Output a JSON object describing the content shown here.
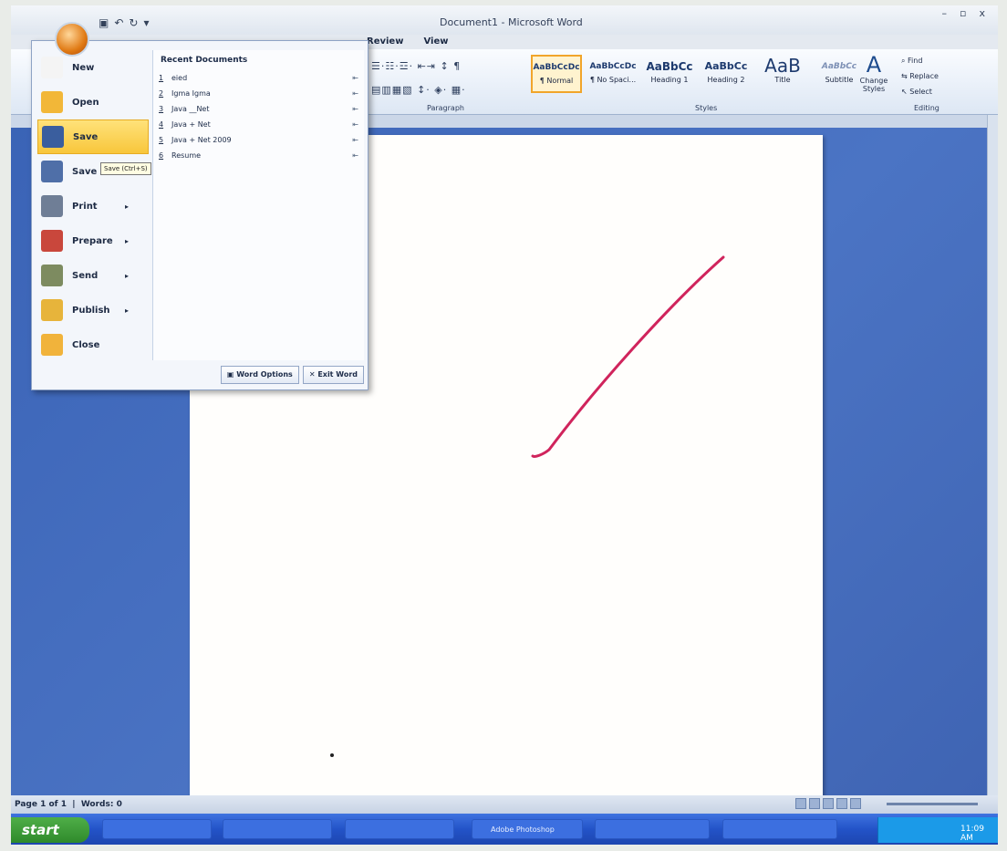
{
  "window": {
    "title": "Document1 - Microsoft Word",
    "minimize": "–",
    "maximize": "▫",
    "close": "x"
  },
  "quick_access": {
    "save": "▣",
    "undo": "↶",
    "redo": "↻",
    "customize": "▾"
  },
  "ribbon": {
    "tabs": [
      "Review",
      "View"
    ],
    "paragraph_group": "Paragraph",
    "para_row1": "☰·☷·☲· ⇤⇥ ↕ ¶",
    "para_row2": "▤▥▦▧ ↕· ◈· ▦·",
    "styles_group": "Styles",
    "styles": [
      {
        "sample": "AaBbCcDc",
        "name": "¶ Normal"
      },
      {
        "sample": "AaBbCcDc",
        "name": "¶ No Spaci..."
      },
      {
        "sample": "AaBbCc",
        "name": "Heading 1"
      },
      {
        "sample": "AaBbCc",
        "name": "Heading 2"
      },
      {
        "sample": "AaB",
        "name": "Title"
      },
      {
        "sample": "AaBbCc",
        "name": "Subtitle"
      }
    ],
    "change_styles": "Change Styles",
    "find": "Find",
    "replace": "Replace",
    "select": "Select",
    "editing_group": "Editing"
  },
  "office_menu": {
    "items": [
      {
        "label": "New",
        "color": "#f4f4f4"
      },
      {
        "label": "Open",
        "color": "#f2b738"
      },
      {
        "label": "Save",
        "color": "#3a5e9e"
      },
      {
        "label": "Save As",
        "color": "#4f6fa8"
      },
      {
        "label": "Print",
        "color": "#6f7e96"
      },
      {
        "label": "Prepare",
        "color": "#c9473c"
      },
      {
        "label": "Send",
        "color": "#7d8b60"
      },
      {
        "label": "Publish",
        "color": "#e7b43b"
      },
      {
        "label": "Close",
        "color": "#f1b33b"
      }
    ],
    "recent_title": "Recent Documents",
    "recent": [
      {
        "num": "1",
        "name": "eied"
      },
      {
        "num": "2",
        "name": "Igma Igma"
      },
      {
        "num": "3",
        "name": "Java __Net"
      },
      {
        "num": "4",
        "name": "Java + Net"
      },
      {
        "num": "5",
        "name": "Java + Net 2009"
      },
      {
        "num": "6",
        "name": "Resume"
      }
    ],
    "pin": "⇤",
    "word_options": "Word Options",
    "exit_word": "Exit Word",
    "tooltip": "Save (Ctrl+S)"
  },
  "status": {
    "page": "Page 1 of 1",
    "words": "Words: 0"
  },
  "taskbar": {
    "start": "start",
    "clock": "11:09 AM",
    "tasks": [
      "",
      "",
      "",
      "Adobe Photoshop",
      "",
      ""
    ]
  }
}
